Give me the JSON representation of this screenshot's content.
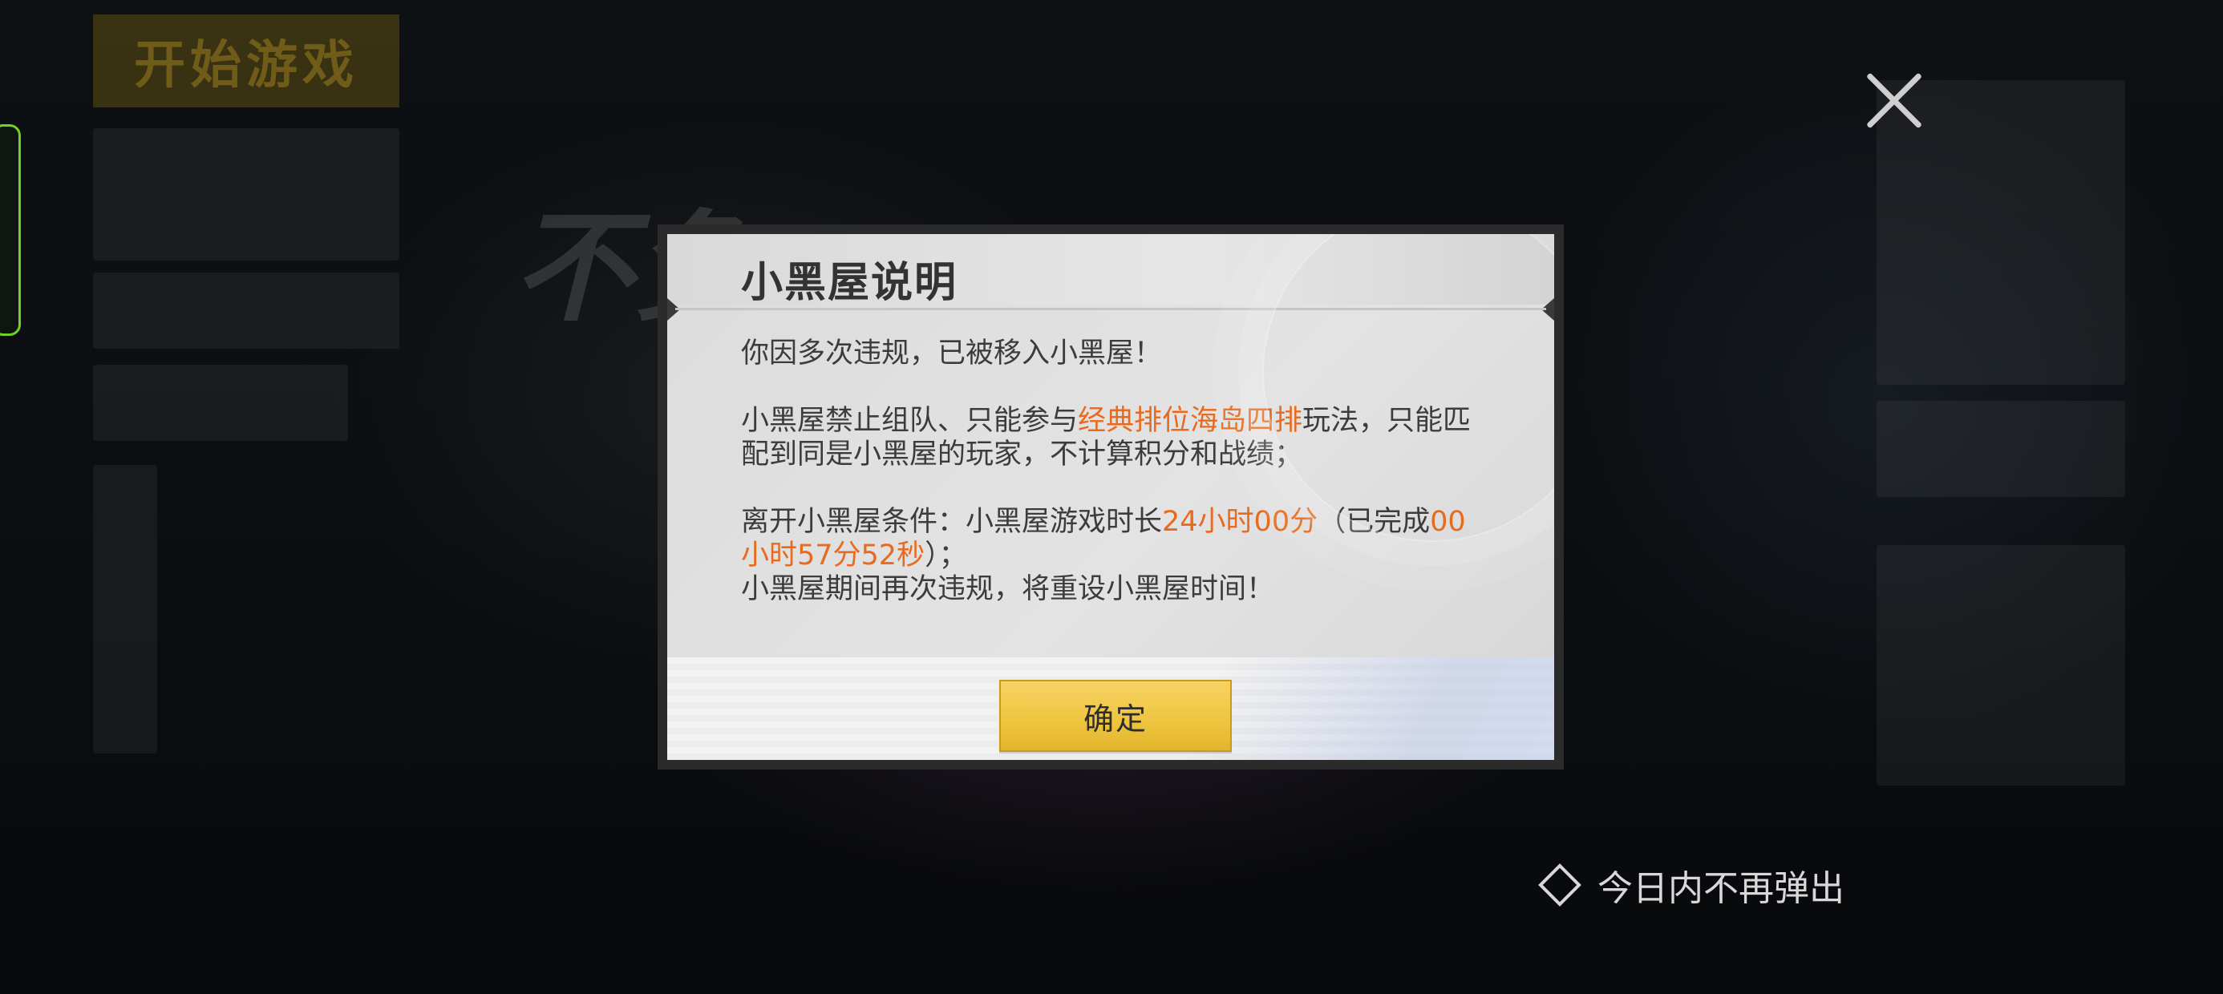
{
  "background": {
    "start_game": "开始游戏",
    "slogan": "不负"
  },
  "dialog": {
    "title": "小黑屋说明",
    "line1": "你因多次违规，已被移入小黑屋！",
    "p2_a": "小黑屋禁止组队、只能参与",
    "p2_mode": "经典排位海岛四排",
    "p2_b": "玩法，只能匹配到同是小黑屋的玩家，不计算积分和战绩；",
    "p3_a": "离开小黑屋条件：小黑屋游戏时长",
    "p3_req": "24小时00分",
    "p3_b": "（已完成",
    "p3_done": "00小时57分52秒",
    "p3_c": "）；",
    "p4": "小黑屋期间再次违规，将重设小黑屋时间！",
    "confirm_label": "确定"
  },
  "no_popup_today": "今日内不再弹出",
  "colors": {
    "highlight": "#e86a1e",
    "confirm_button": "#f2c94c",
    "edge_handle": "#6fd22a"
  }
}
